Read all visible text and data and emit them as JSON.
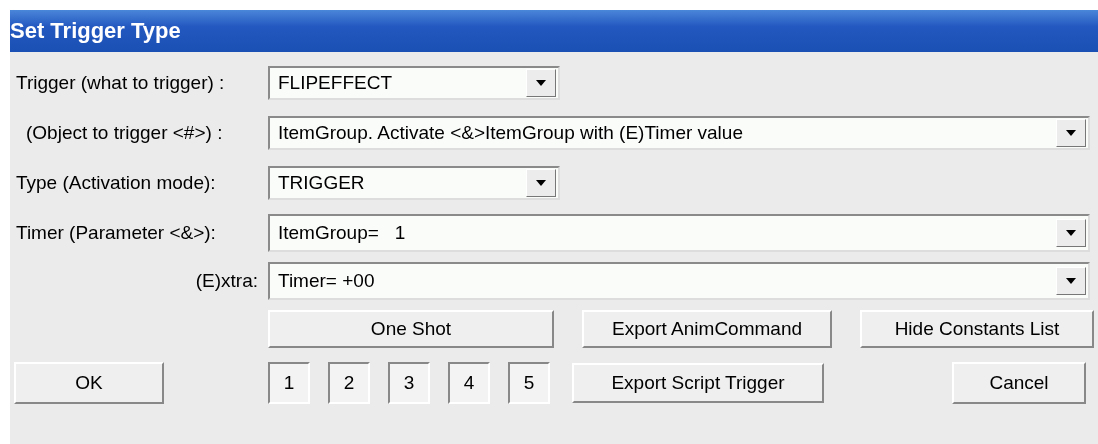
{
  "window": {
    "title": "Set Trigger Type"
  },
  "fields": [
    {
      "label": "Trigger (what to trigger) :",
      "value": "FLIPEFFECT"
    },
    {
      "label": "(Object to trigger <#>) :",
      "value": "ItemGroup. Activate <&>ItemGroup with (E)Timer value"
    },
    {
      "label": "Type (Activation mode):",
      "value": "TRIGGER"
    },
    {
      "label": "Timer (Parameter <&>):",
      "value": "ItemGroup=   1"
    },
    {
      "label": "(E)xtra:",
      "value": "Timer= +00"
    }
  ],
  "buttons_row": [
    "One Shot",
    "Export AnimCommand",
    "Hide Constants List"
  ],
  "ok_button": "OK",
  "mask_buttons": [
    "1",
    "2",
    "3",
    "4",
    "5"
  ],
  "export_script_button": "Export Script Trigger",
  "cancel_button": "Cancel"
}
